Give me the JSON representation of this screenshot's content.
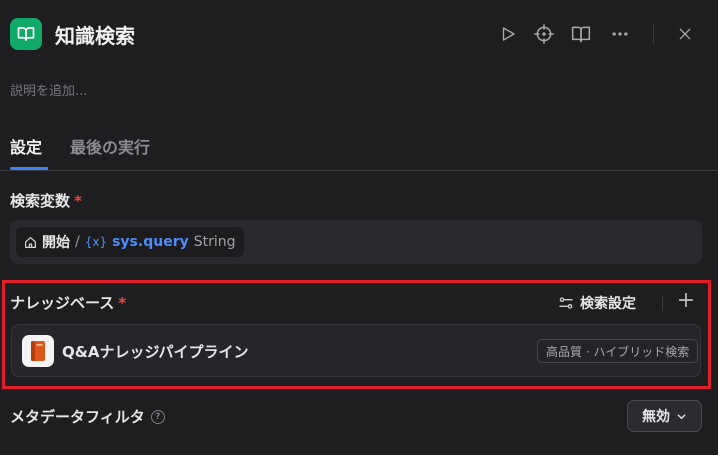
{
  "header": {
    "title": "知識検索",
    "icon": "book-open-icon",
    "accent_color": "#0fa968",
    "actions": [
      {
        "name": "run-button",
        "icon": "play-icon"
      },
      {
        "name": "locate-button",
        "icon": "crosshair-icon"
      },
      {
        "name": "docs-button",
        "icon": "book-icon"
      },
      {
        "name": "more-button",
        "icon": "more-horizontal-icon"
      },
      {
        "name": "close-button",
        "icon": "close-icon"
      }
    ]
  },
  "description": {
    "placeholder": "説明を追加..."
  },
  "tabs": [
    {
      "label": "設定",
      "active": true
    },
    {
      "label": "最後の実行",
      "active": false
    }
  ],
  "search_variable": {
    "label": "検索変数",
    "required_mark": "*",
    "chip": {
      "node": "開始",
      "separator": "/",
      "var_icon": "{x}",
      "variable": "sys.query",
      "type": "String"
    }
  },
  "knowledge_base": {
    "label": "ナレッジベース",
    "required_mark": "*",
    "settings_label": "検索設定",
    "add_symbol": "+",
    "items": [
      {
        "name": "Q&Aナレッジパイプライン",
        "badge": "高品質 · ハイブリッド検索",
        "icon": "book-icon"
      }
    ],
    "highlight_color": "#e11d2a"
  },
  "metadata_filter": {
    "label": "メタデータフィルタ",
    "help_symbol": "?",
    "value": "無効"
  }
}
